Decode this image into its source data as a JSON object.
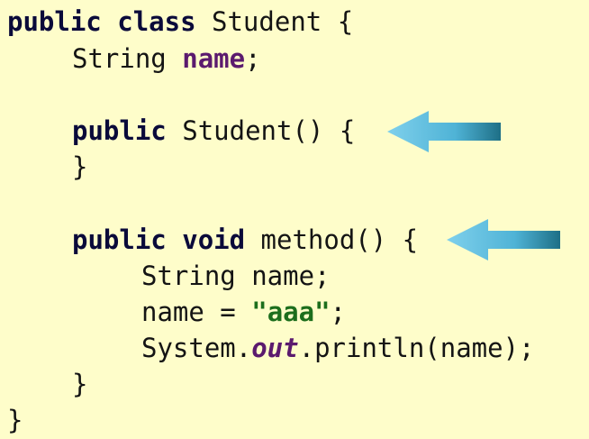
{
  "code": {
    "line1": {
      "kw1": "public",
      "kw2": "class",
      "rest": "Student {"
    },
    "line2": {
      "type": "String",
      "field": "name",
      "end": ";"
    },
    "line3": {
      "kw": "public",
      "rest": "Student() {"
    },
    "line4": {
      "text": "}"
    },
    "line5": {
      "kw1": "public",
      "kw2": "void",
      "rest": "method() {"
    },
    "line6": {
      "text": "String name;"
    },
    "line7": {
      "pre": "name =",
      "str": "\"aaa\"",
      "end": ";"
    },
    "line8": {
      "pre": "System.",
      "static": "out",
      "end": ".println(name);"
    },
    "line9": {
      "text": "}"
    },
    "line10": {
      "text": "}"
    }
  },
  "arrows": [
    {
      "name": "constructor-pointer-arrow",
      "direction": "left",
      "color": "#4fb3d6"
    },
    {
      "name": "method-pointer-arrow",
      "direction": "left",
      "color": "#4fb3d6"
    }
  ],
  "colors": {
    "background": "#fefdca",
    "keyword": "#0a0a3a",
    "field": "#5b1a6e",
    "string": "#1c6e1c",
    "arrow": "#4fb3d6"
  }
}
